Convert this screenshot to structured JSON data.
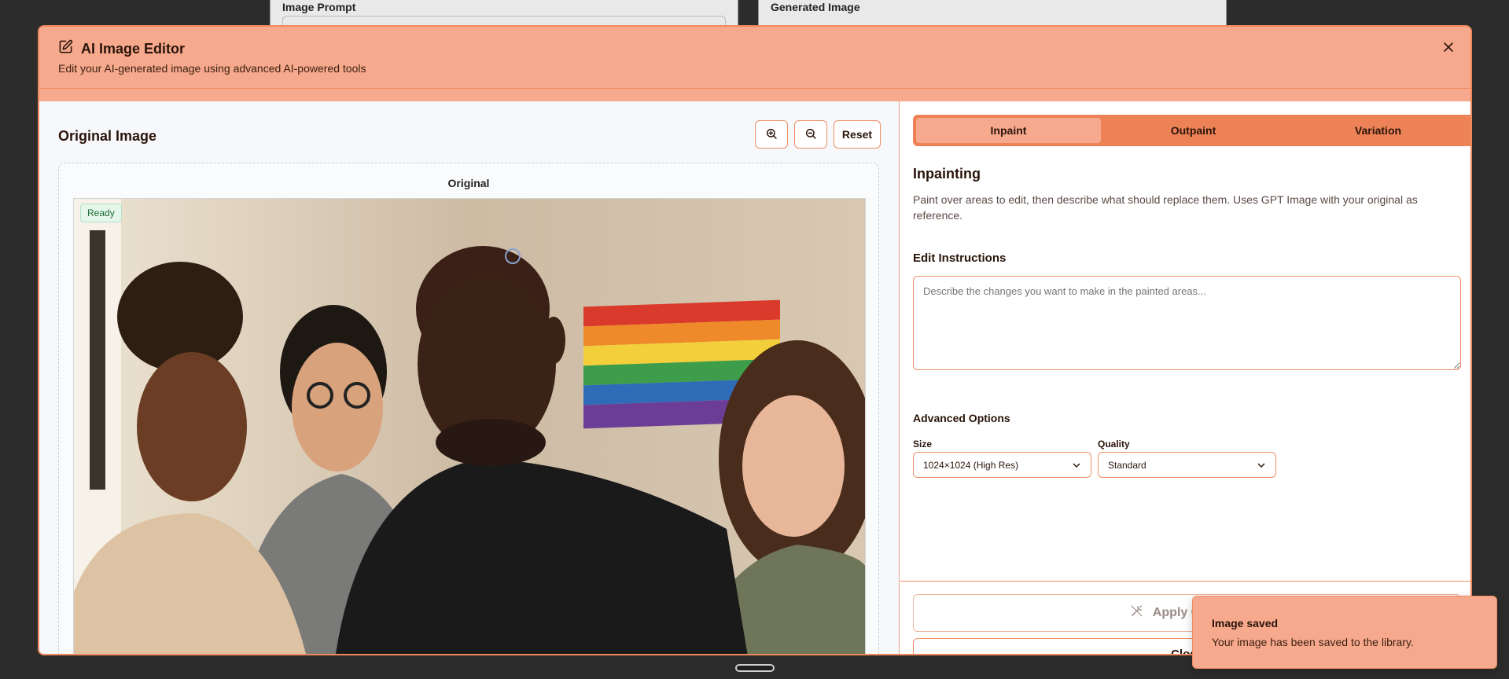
{
  "background": {
    "left_card_label": "Image Prompt",
    "right_card_label": "Generated Image"
  },
  "modal": {
    "title": "AI Image Editor",
    "subtitle": "Edit your AI-generated image using advanced AI-powered tools",
    "close_icon": "close-icon"
  },
  "left": {
    "title": "Original Image",
    "zoom_in_icon": "zoom-in-icon",
    "zoom_out_icon": "zoom-out-icon",
    "reset_label": "Reset",
    "canvas_label": "Original",
    "status_badge": "Ready"
  },
  "right": {
    "tabs": [
      {
        "label": "Inpaint",
        "active": true
      },
      {
        "label": "Outpaint",
        "active": false
      },
      {
        "label": "Variation",
        "active": false
      }
    ],
    "section_title": "Inpainting",
    "section_desc": "Paint over areas to edit, then describe what should replace them. Uses GPT Image with your original as reference.",
    "instructions_label": "Edit Instructions",
    "instructions_placeholder": "Describe the changes you want to make in the painted areas...",
    "advanced_label": "Advanced Options",
    "size_label": "Size",
    "size_value": "1024×1024 (High Res)",
    "quality_label": "Quality",
    "quality_value": "Standard",
    "apply_label": "Apply Changes",
    "close_label": "Close"
  },
  "toast": {
    "title": "Image saved",
    "message": "Your image has been saved to the library."
  },
  "colors": {
    "accent": "#ee8257",
    "header_bg": "#f6a98c",
    "border": "#ee8e66"
  }
}
